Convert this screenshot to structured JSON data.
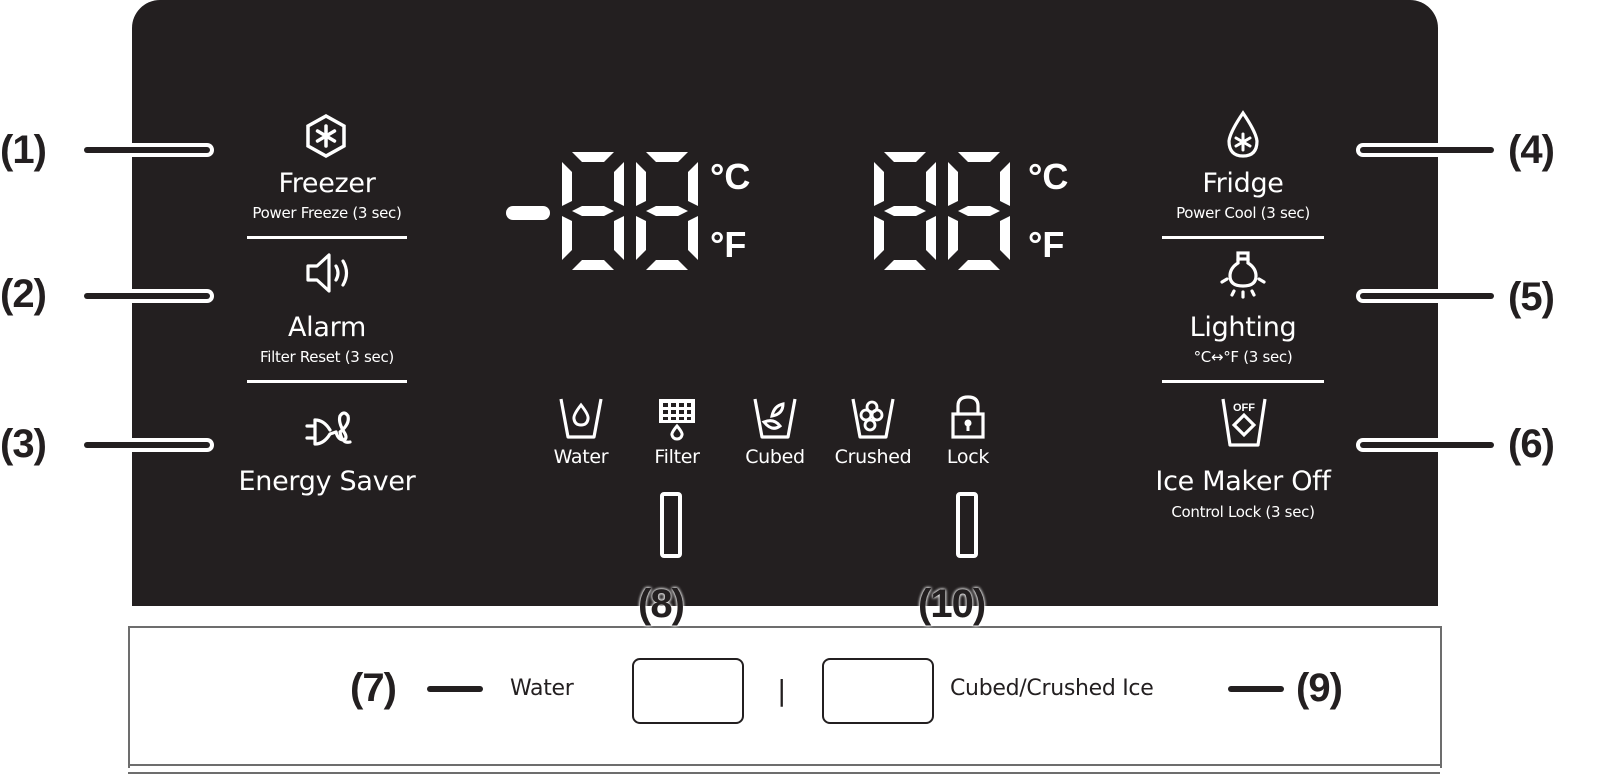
{
  "diagram": {
    "title": "Refrigerator control panel",
    "colors": {
      "panel": "#231f20",
      "foreground": "#ffffff",
      "callout": "#231f20"
    }
  },
  "callouts": {
    "c1": "(1)",
    "c2": "(2)",
    "c3": "(3)",
    "c4": "(4)",
    "c5": "(5)",
    "c6": "(6)",
    "c7": "(7)",
    "c8": "(8)",
    "c9": "(9)",
    "c10": "(10)"
  },
  "left_buttons": [
    {
      "icon": "snowflake-hexagon-icon",
      "title": "Freezer",
      "subtitle": "Power Freeze (3 sec)"
    },
    {
      "icon": "speaker-icon",
      "title": "Alarm",
      "subtitle": "Filter Reset (3 sec)"
    },
    {
      "icon": "plug-icon",
      "title": "Energy Saver",
      "subtitle": ""
    }
  ],
  "right_buttons": [
    {
      "icon": "drop-snowflake-icon",
      "title": "Fridge",
      "subtitle": "Power Cool (3 sec)"
    },
    {
      "icon": "lightbulb-icon",
      "title": "Lighting",
      "subtitle": "°C↔°F (3 sec)"
    },
    {
      "icon": "ice-off-icon",
      "title": "Ice Maker Off",
      "subtitle": "Control Lock (3 sec)"
    }
  ],
  "displays": {
    "freezer": {
      "value": "-88",
      "unit_c": "°C",
      "unit_f": "°F"
    },
    "fridge": {
      "value": "88",
      "unit_c": "°C",
      "unit_f": "°F"
    }
  },
  "indicators": [
    {
      "icon": "water-glass-icon",
      "label": "Water"
    },
    {
      "icon": "filter-icon",
      "label": "Filter"
    },
    {
      "icon": "cubed-ice-icon",
      "label": "Cubed"
    },
    {
      "icon": "crushed-ice-icon",
      "label": "Crushed"
    },
    {
      "icon": "lock-icon",
      "label": "Lock"
    }
  ],
  "dispenser": {
    "water_label": "Water",
    "ice_label": "Cubed/Crushed Ice",
    "separator": "|"
  }
}
